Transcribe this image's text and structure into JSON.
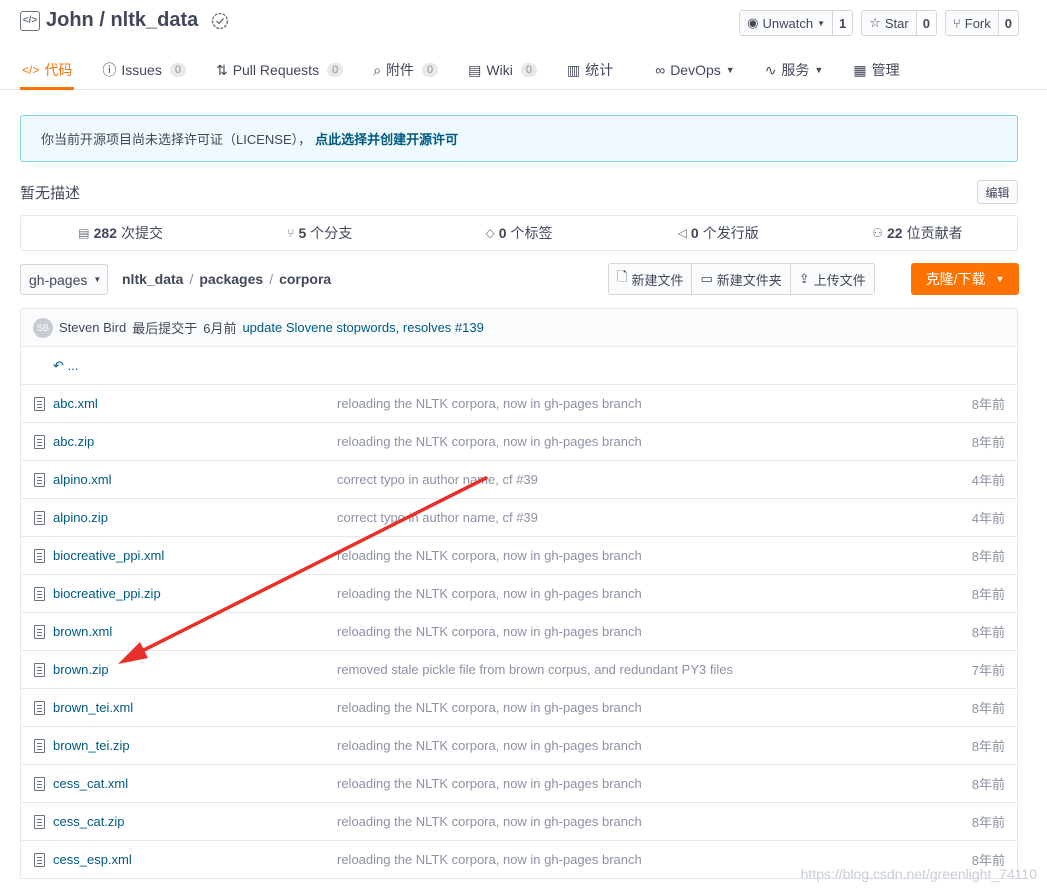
{
  "header": {
    "title": "John / nltk_data",
    "watch": {
      "label": "Unwatch",
      "count": "1"
    },
    "star": {
      "label": "Star",
      "count": "0"
    },
    "fork": {
      "label": "Fork",
      "count": "0"
    }
  },
  "tabs": [
    {
      "label": "代码",
      "count": "",
      "icon": "code-icon"
    },
    {
      "label": "Issues",
      "count": "0",
      "icon": "issue-icon"
    },
    {
      "label": "Pull Requests",
      "count": "0",
      "icon": "pull-request-icon"
    },
    {
      "label": "附件",
      "count": "0",
      "icon": "attachment-icon"
    },
    {
      "label": "Wiki",
      "count": "0",
      "icon": "wiki-icon"
    },
    {
      "label": "统计",
      "count": "",
      "icon": "stats-icon"
    },
    {
      "label": "DevOps",
      "count": "",
      "icon": "devops-icon"
    },
    {
      "label": "服务",
      "count": "",
      "icon": "service-icon"
    },
    {
      "label": "管理",
      "count": "",
      "icon": "manage-icon"
    }
  ],
  "license": {
    "text": "你当前开源项目尚未选择许可证（LICENSE），",
    "link": "点此选择并创建开源许可"
  },
  "description": "暂无描述",
  "edit_label": "编辑",
  "stats": {
    "commits": {
      "count": "282",
      "label": "次提交"
    },
    "branches": {
      "count": "5",
      "label": "个分支"
    },
    "tags": {
      "count": "0",
      "label": "个标签"
    },
    "releases": {
      "count": "0",
      "label": "个发行版"
    },
    "contributors": {
      "count": "22",
      "label": "位贡献者"
    }
  },
  "branch": "gh-pages",
  "breadcrumb": [
    "nltk_data",
    "packages",
    "corpora"
  ],
  "file_actions": {
    "new_file": "新建文件",
    "new_folder": "新建文件夹",
    "upload": "上传文件"
  },
  "clone_label": "克隆/下载",
  "commit": {
    "avatar": "SB",
    "author": "Steven Bird",
    "time_prefix": "最后提交于",
    "time": "6月前",
    "message": "update Slovene stopwords, resolves #139"
  },
  "up_label": "...",
  "files": [
    {
      "name": "abc.xml",
      "message": "reloading the NLTK corpora, now in gh-pages branch",
      "time": "8年前"
    },
    {
      "name": "abc.zip",
      "message": "reloading the NLTK corpora, now in gh-pages branch",
      "time": "8年前"
    },
    {
      "name": "alpino.xml",
      "message": "correct typo in author name, cf #39",
      "time": "4年前"
    },
    {
      "name": "alpino.zip",
      "message": "correct typo in author name, cf #39",
      "time": "4年前"
    },
    {
      "name": "biocreative_ppi.xml",
      "message": "reloading the NLTK corpora, now in gh-pages branch",
      "time": "8年前"
    },
    {
      "name": "biocreative_ppi.zip",
      "message": "reloading the NLTK corpora, now in gh-pages branch",
      "time": "8年前"
    },
    {
      "name": "brown.xml",
      "message": "reloading the NLTK corpora, now in gh-pages branch",
      "time": "8年前"
    },
    {
      "name": "brown.zip",
      "message": "removed stale pickle file from brown corpus, and redundant PY3 files",
      "time": "7年前"
    },
    {
      "name": "brown_tei.xml",
      "message": "reloading the NLTK corpora, now in gh-pages branch",
      "time": "8年前"
    },
    {
      "name": "brown_tei.zip",
      "message": "reloading the NLTK corpora, now in gh-pages branch",
      "time": "8年前"
    },
    {
      "name": "cess_cat.xml",
      "message": "reloading the NLTK corpora, now in gh-pages branch",
      "time": "8年前"
    },
    {
      "name": "cess_cat.zip",
      "message": "reloading the NLTK corpora, now in gh-pages branch",
      "time": "8年前"
    },
    {
      "name": "cess_esp.xml",
      "message": "reloading the NLTK corpora, now in gh-pages branch",
      "time": "8年前"
    }
  ],
  "watermark": "https://blog.csdn.net/greenlight_74110",
  "colors": {
    "accent": "#fe7300",
    "link": "#005980",
    "annotation_arrow": "#e8302a"
  }
}
